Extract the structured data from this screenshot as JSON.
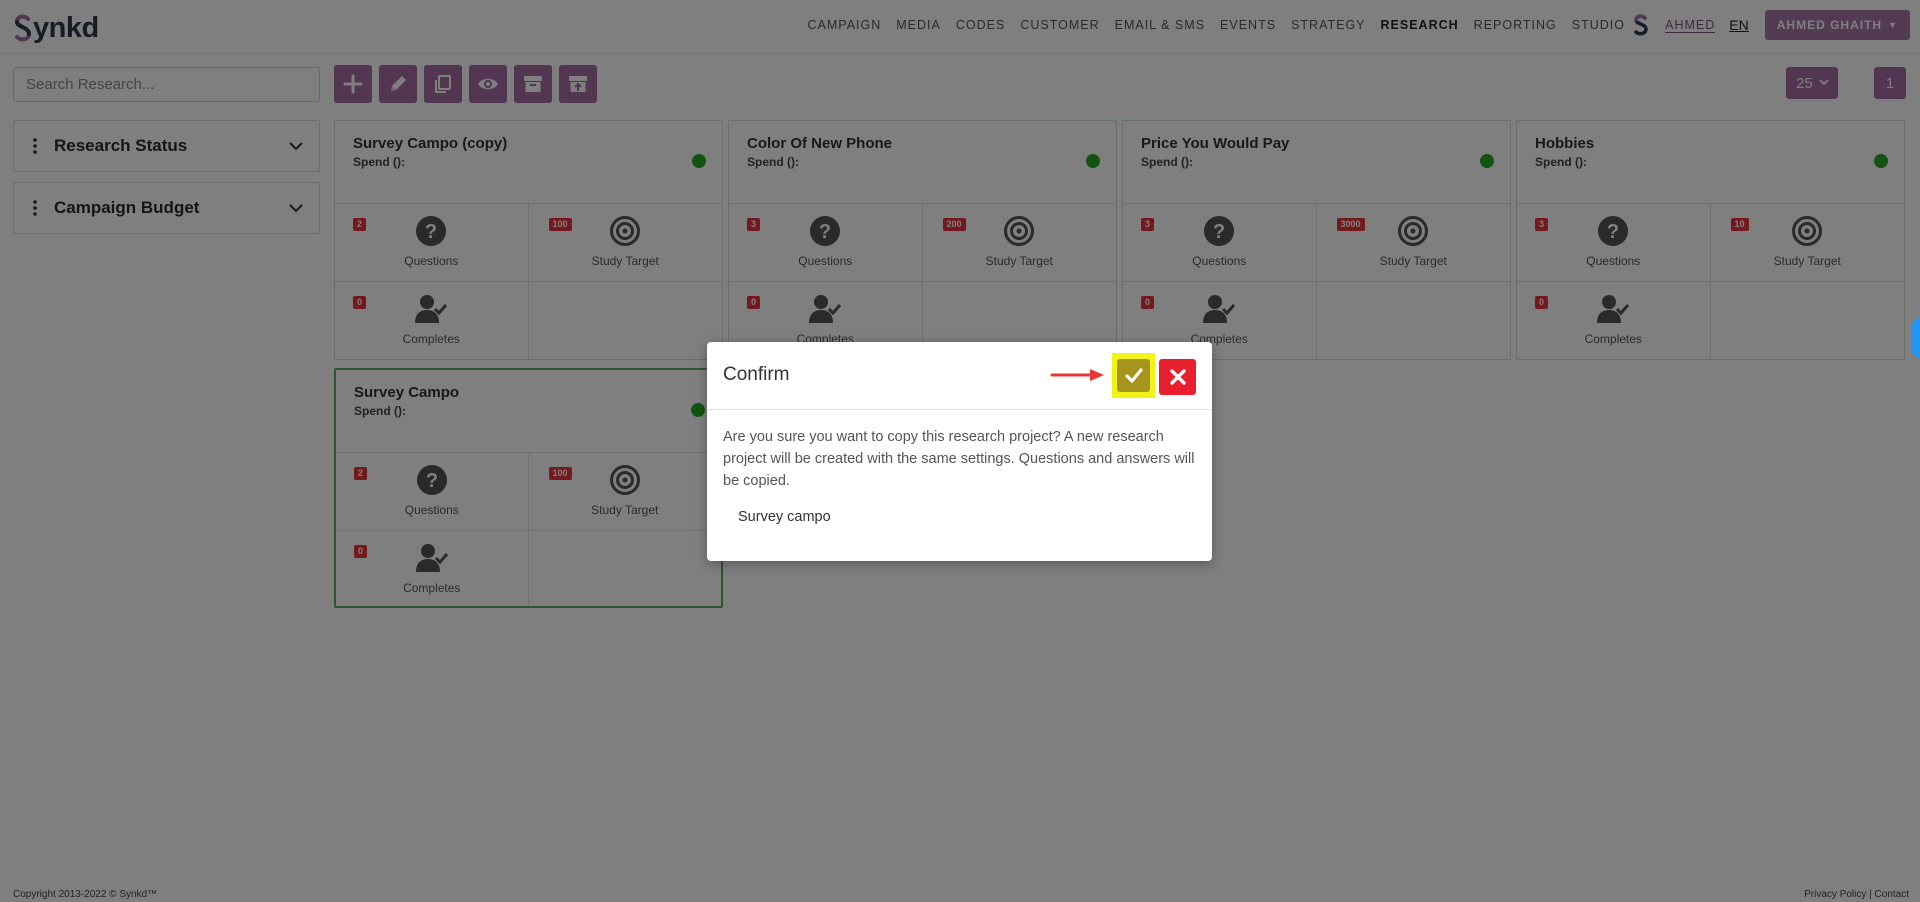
{
  "header": {
    "logo_text": "ynkd",
    "nav": [
      "CAMPAIGN",
      "MEDIA",
      "CODES",
      "CUSTOMER",
      "EMAIL & SMS",
      "EVENTS",
      "STRATEGY",
      "RESEARCH",
      "REPORTING",
      "STUDIO"
    ],
    "active_nav": "RESEARCH",
    "user_link": "AHMED",
    "lang": "EN",
    "user_button": "AHMED GHAITH"
  },
  "toolbar": {
    "search_placeholder": "Search Research...",
    "page_size": "25",
    "page_number": "1"
  },
  "sidebar": {
    "filters": [
      "Research Status",
      "Campaign Budget"
    ]
  },
  "cards": [
    {
      "title": "Survey Campo (copy)",
      "spend": "Spend ():",
      "questions": "2",
      "target": "100",
      "completes": "0"
    },
    {
      "title": "Color Of New Phone",
      "spend": "Spend ():",
      "questions": "3",
      "target": "200",
      "completes": "0"
    },
    {
      "title": "Price You Would Pay",
      "spend": "Spend ():",
      "questions": "3",
      "target": "3000",
      "completes": "0"
    },
    {
      "title": "Hobbies",
      "spend": "Spend ():",
      "questions": "3",
      "target": "10",
      "completes": "0"
    },
    {
      "title": "Survey Campo",
      "spend": "Spend ():",
      "questions": "2",
      "target": "100",
      "completes": "0"
    }
  ],
  "card_labels": {
    "questions": "Questions",
    "target": "Study Target",
    "completes": "Completes"
  },
  "modal": {
    "title": "Confirm",
    "message": "Are you sure you want to copy this research project? A new research project will be created with the same settings. Questions and answers will be copied.",
    "project_name": "Survey campo"
  },
  "footer": {
    "copyright": "Copyright 2013-2022 © Synkd™",
    "links": "Privacy Policy | Contact"
  },
  "colors": {
    "accent": "#a56ca5",
    "status_green": "#27a927",
    "badge_red": "#e8323c",
    "confirm_highlight": "#f3f31a",
    "close_red": "#e8202e"
  }
}
